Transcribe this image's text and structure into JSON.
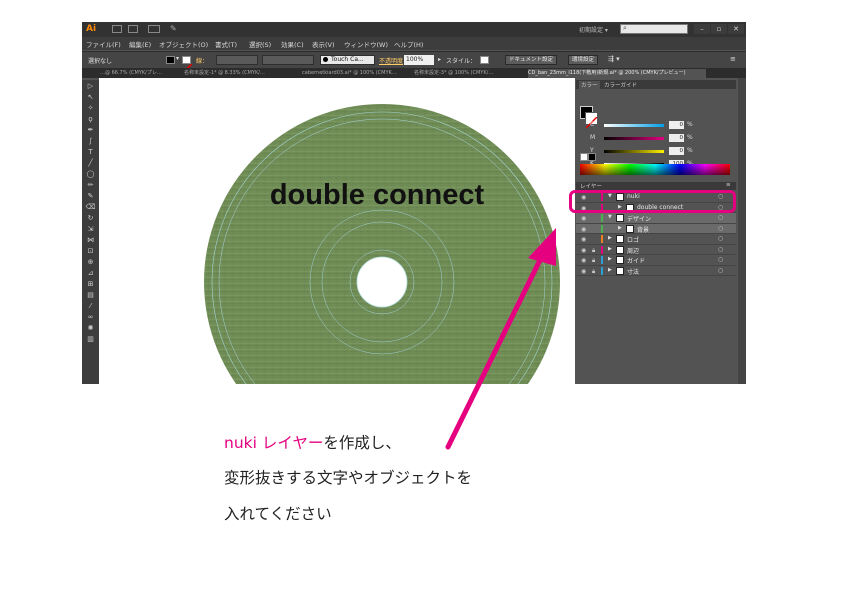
{
  "titlebar": {
    "app_logo": "Ai",
    "workspace": "初期設定",
    "window_buttons": [
      "–",
      "▫",
      "✕"
    ]
  },
  "menubar": {
    "items": [
      "ファイル(F)",
      "編集(E)",
      "オブジェクト(O)",
      "書式(T)",
      "選択(S)",
      "効果(C)",
      "表示(V)",
      "ウィンドウ(W)",
      "ヘルプ(H)"
    ]
  },
  "control_bar": {
    "selection_label": "選択なし",
    "stroke_label": "線：",
    "brush_name": "Touch Ca...",
    "opacity_label": "不透明度",
    "opacity_value": "100%",
    "style_label": "スタイル：",
    "doc_settings_button": "ドキュメント設定",
    "preferences_button": "環境設定"
  },
  "doc_tabs": [
    "…@ 66.7% (CMYK/プレ…",
    "名称未設定-1* @ 8.33% (CMYK/…",
    "cabernetkiard03.ai* @ 100% (CMYK…",
    "名称未設定-3* @ 100% (CMYK/…",
    "CD_ban_23mm_i118(下敷用)新規.ai* @ 200% (CMYK/プレビュー)"
  ],
  "canvas": {
    "disc_text": "double connect"
  },
  "color_panel": {
    "tabs": [
      "カラー",
      "カラーガイド"
    ],
    "sliders": [
      {
        "label": "C",
        "value": "0",
        "unit": "%",
        "color": "#00a0e9"
      },
      {
        "label": "M",
        "value": "0",
        "unit": "%",
        "color": "#e4007f"
      },
      {
        "label": "Y",
        "value": "0",
        "unit": "%",
        "color": "#fff100"
      },
      {
        "label": "K",
        "value": "100",
        "unit": "%",
        "color": "#000000"
      }
    ]
  },
  "layers_panel": {
    "tab_label": "レイヤー",
    "rows": [
      {
        "name": "nuki",
        "level": 0,
        "color": "#e4007f",
        "expanded": true,
        "locked": false
      },
      {
        "name": "double connect",
        "level": 1,
        "color": "#e4007f",
        "expanded": false,
        "locked": false
      },
      {
        "name": "デザイン",
        "level": 0,
        "color": "#4caf50",
        "expanded": true,
        "locked": false
      },
      {
        "name": "背景",
        "level": 1,
        "color": "#4caf50",
        "expanded": false,
        "locked": false
      },
      {
        "name": "ロゴ",
        "level": 0,
        "color": "#e67e22",
        "expanded": false,
        "locked": false
      },
      {
        "name": "周辺",
        "level": 0,
        "color": "#e4007f",
        "expanded": false,
        "locked": true
      },
      {
        "name": "ガイド",
        "level": 0,
        "color": "#2b9fd8",
        "expanded": false,
        "locked": true
      },
      {
        "name": "寸法",
        "level": 0,
        "color": "#2b9fd8",
        "expanded": false,
        "locked": true
      }
    ]
  },
  "annotation": {
    "highlight_color": "#e4007f",
    "line1_pink": "nuki レイヤー",
    "line1_rest": "を作成し、",
    "line2": "変形抜きする文字やオブジェクトを",
    "line3": "入れてください"
  }
}
